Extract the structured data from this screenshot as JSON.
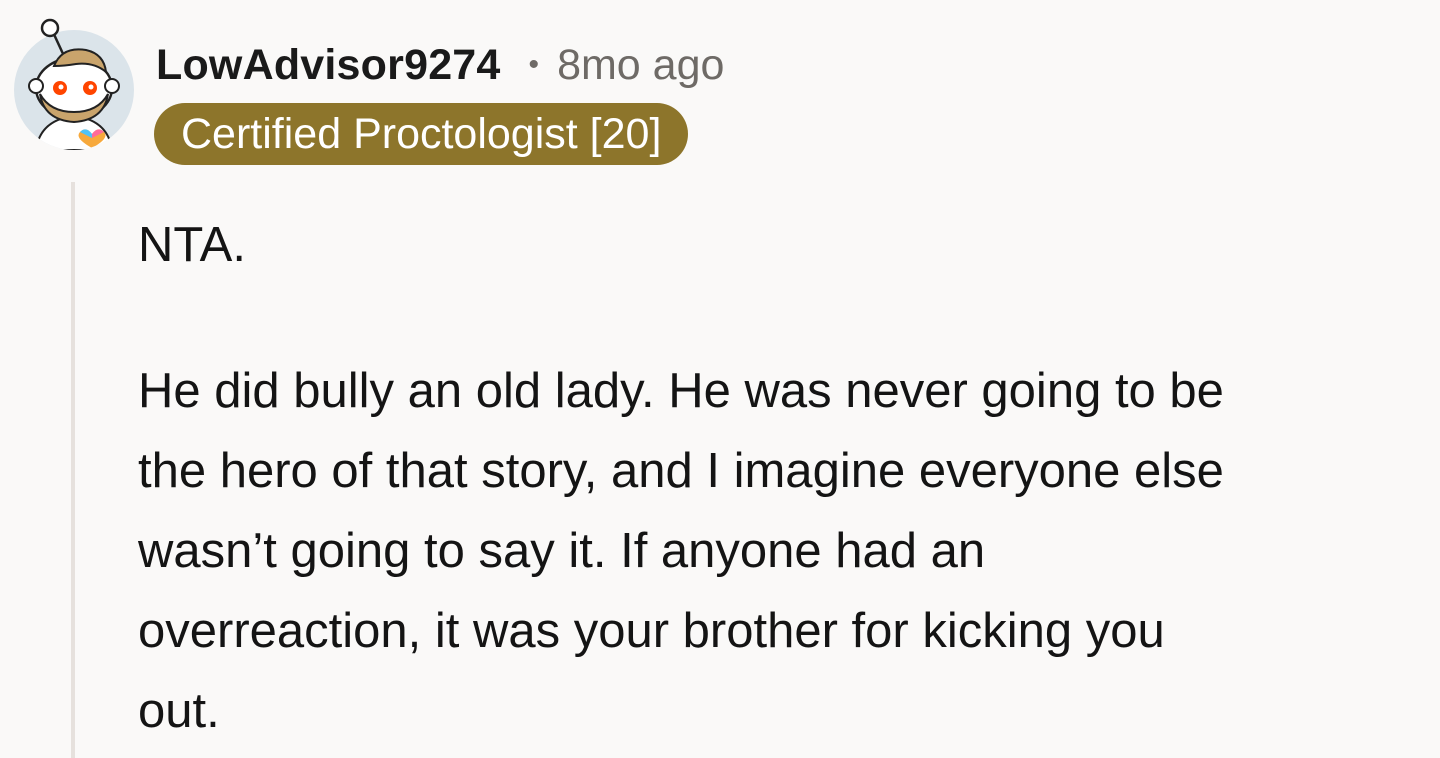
{
  "comment": {
    "author": "LowAdvisor9274",
    "separator": "•",
    "timestamp": "8mo ago",
    "flair": "Certified Proctologist [20]",
    "flair_color": "#8d752b",
    "avatar_icon": "snoo-avatar-icon",
    "body": {
      "p1": "NTA.",
      "p2_lines": [
        "He did bully an old lady. He was never going to be",
        "the hero of that story, and I imagine everyone else",
        "wasn’t going to say it. If anyone had an",
        "overreaction, it was your brother for kicking you",
        "out."
      ]
    }
  }
}
